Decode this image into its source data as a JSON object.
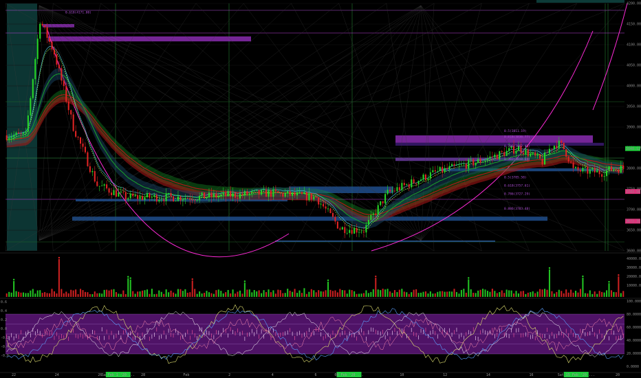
{
  "chart_data": {
    "type": "candlestick",
    "panels": [
      "price",
      "volume",
      "oscillator"
    ],
    "colors": {
      "background": "#000000",
      "up": "#26d626",
      "down": "#e02424",
      "fib_line": "#b04fd8",
      "zone_purple": "#8a2bb0",
      "zone_blue": "#1f4e8c",
      "arc": "#ff2ad8",
      "grid_green": "#1f6b2a",
      "ema_red": "#b01818",
      "ema_green": "#1aa32a",
      "ema_cyan": "#4ec8e0",
      "osc_band": "#6a1a8a",
      "label_green": "#1ecb3a",
      "label_pink": "#e0307a"
    },
    "price_axis": {
      "min": 3600,
      "max": 4200,
      "ticks": [
        "4200.00",
        "4150.00",
        "4100.00",
        "4050.00",
        "4000.00",
        "3950.00",
        "3900.00",
        "3850.00",
        "3800.00",
        "3750.00",
        "3700.00",
        "3650.00",
        "3600.00"
      ],
      "markers": [
        {
          "label": "3848.12",
          "value": 3848,
          "color": "label_green"
        },
        {
          "label": "3743.58",
          "value": 3744,
          "color": "label_pink"
        },
        {
          "label": "3672.35",
          "value": 3672,
          "color": "label_pink"
        }
      ]
    },
    "fib_labels": [
      {
        "text": "0.5(3811.19)",
        "value": 3888
      },
      {
        "text": "0.618(3836.77)",
        "value": 3874
      },
      {
        "text": "0.786(3862.45)",
        "value": 3852
      },
      {
        "text": "0.382(3810.84)",
        "value": 3820
      },
      {
        "text": "0.5(3785.58)",
        "value": 3776
      },
      {
        "text": "0.618(3757.61)",
        "value": 3756
      },
      {
        "text": "0.786(3727.29)",
        "value": 3736
      },
      {
        "text": "0.886(3703.48)",
        "value": 3700
      },
      {
        "text": "0.618(4171.00)",
        "value": 4176
      }
    ],
    "volume_axis": {
      "ticks": [
        "40000.0K",
        "30000.0K",
        "20000.0K",
        "10000.0K"
      ]
    },
    "oscillator_axis": {
      "ticks_right": [
        "100.0000",
        "80.0000",
        "60.0000",
        "40.0000",
        "20.0000",
        "0.0000"
      ],
      "ticks_left": [
        "0.6",
        "0.4",
        "0.2",
        "0.0",
        "-0.2",
        "-0.4",
        "-0.6"
      ],
      "band": [
        20,
        80
      ]
    },
    "x_axis": {
      "ticks": [
        "22",
        "24",
        "26",
        "28",
        "Feb",
        "2",
        "4",
        "6",
        "8",
        "10",
        "12",
        "14",
        "16",
        "18",
        "20"
      ],
      "highlights": [
        {
          "text": "Sa Feb 1 '20 ...",
          "at": 0.182
        },
        {
          "text": "08 Feb '20 ...",
          "at": 0.555
        },
        {
          "text": "Sat 15 Feb '20 ...",
          "at": 0.922
        }
      ]
    }
  }
}
